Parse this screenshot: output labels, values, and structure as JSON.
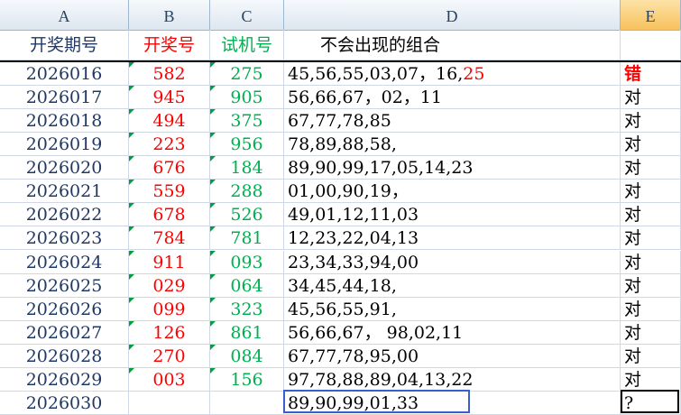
{
  "columns": [
    "A",
    "B",
    "C",
    "D",
    "E"
  ],
  "headers": {
    "a": "开奖期号",
    "b": "开奖号",
    "c": "试机号",
    "d": "不会出现的组合",
    "e": ""
  },
  "rows": [
    {
      "period": "2026016",
      "draw": "582",
      "test": "275",
      "combo": "45,56,55,03,07，16,",
      "combo_red": "25",
      "result": "错"
    },
    {
      "period": "2026017",
      "draw": "945",
      "test": "905",
      "combo": "56,66,67，02，11",
      "combo_red": "",
      "result": "对"
    },
    {
      "period": "2026018",
      "draw": "494",
      "test": "375",
      "combo": "67,77,78,85",
      "combo_red": "",
      "result": "对"
    },
    {
      "period": "2026019",
      "draw": "223",
      "test": "956",
      "combo": "78,89,88,58,",
      "combo_red": "",
      "result": "对"
    },
    {
      "period": "2026020",
      "draw": "676",
      "test": "184",
      "combo": "89,90,99,17,05,14,23",
      "combo_red": "",
      "result": "对"
    },
    {
      "period": "2026021",
      "draw": "559",
      "test": "288",
      "combo": "01,00,90,19，",
      "combo_red": "",
      "result": "对"
    },
    {
      "period": "2026022",
      "draw": "678",
      "test": "526",
      "combo": "49,01,12,11,03",
      "combo_red": "",
      "result": "对"
    },
    {
      "period": "2026023",
      "draw": "784",
      "test": "781",
      "combo": "12,23,22,04,13",
      "combo_red": "",
      "result": "对"
    },
    {
      "period": "2026024",
      "draw": "911",
      "test": "093",
      "combo": "23,34,33,94,00",
      "combo_red": "",
      "result": "对"
    },
    {
      "period": "2026025",
      "draw": "029",
      "test": "064",
      "combo": "34,45,44,18,",
      "combo_red": "",
      "result": "对"
    },
    {
      "period": "2026026",
      "draw": "099",
      "test": "323",
      "combo": "45,56,55,91,",
      "combo_red": "",
      "result": "对"
    },
    {
      "period": "2026027",
      "draw": "126",
      "test": "861",
      "combo": "56,66,67， 98,02,11",
      "combo_red": "",
      "result": "对"
    },
    {
      "period": "2026028",
      "draw": "270",
      "test": "084",
      "combo": "67,77,78,95,00",
      "combo_red": "",
      "result": "对"
    },
    {
      "period": "2026029",
      "draw": "003",
      "test": "156",
      "combo": "97,78,88,89,04,13,22",
      "combo_red": "",
      "result": "对"
    },
    {
      "period": "2026030",
      "draw": "",
      "test": "",
      "combo": "89,90,99,01,33",
      "combo_red": "",
      "result": "?"
    }
  ]
}
